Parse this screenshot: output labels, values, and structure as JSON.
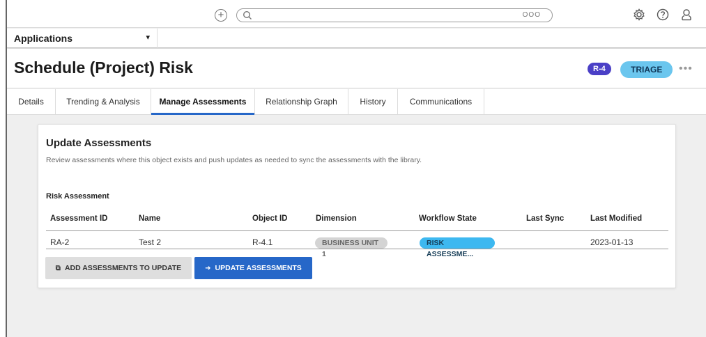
{
  "topbar": {
    "add_icon": "plus-circle-icon",
    "search_placeholder": "",
    "search_more": "OOO",
    "icons": [
      "gear-icon",
      "help-icon",
      "user-icon"
    ]
  },
  "appbar": {
    "label": "Applications",
    "chevron": "⌄"
  },
  "header": {
    "title": "Schedule (Project) Risk",
    "id_badge": "R-4",
    "status_badge": "TRIAGE",
    "more": "•••",
    "colors": {
      "id_badge": "#4a3fc6",
      "status_badge": "#6bc6ee"
    }
  },
  "tabs": [
    {
      "label": "Details"
    },
    {
      "label": "Trending & Analysis"
    },
    {
      "label": "Manage Assessments"
    },
    {
      "label": "Relationship Graph"
    },
    {
      "label": "History"
    },
    {
      "label": "Communications"
    }
  ],
  "active_tab": "Manage Assessments",
  "card": {
    "title": "Update Assessments",
    "description": "Review assessments where this object exists and push updates as needed to sync the assessments with the library.",
    "section": "Risk Assessment",
    "columns": [
      "Assessment ID",
      "Name",
      "Object ID",
      "Dimension",
      "Workflow State",
      "Last Sync",
      "Last Modified"
    ],
    "rows": [
      {
        "assessment_id": "RA-2",
        "name": "Test 2",
        "object_id": "R-4.1",
        "dimension": "BUSINESS UNIT 1",
        "workflow_state": "RISK ASSESSME...",
        "last_sync": "",
        "last_modified": "2023-01-13"
      }
    ],
    "buttons": {
      "add": "ADD ASSESSMENTS TO UPDATE",
      "update": "UPDATE ASSESSMENTS"
    },
    "colors": {
      "primary": "#2667c8"
    }
  }
}
